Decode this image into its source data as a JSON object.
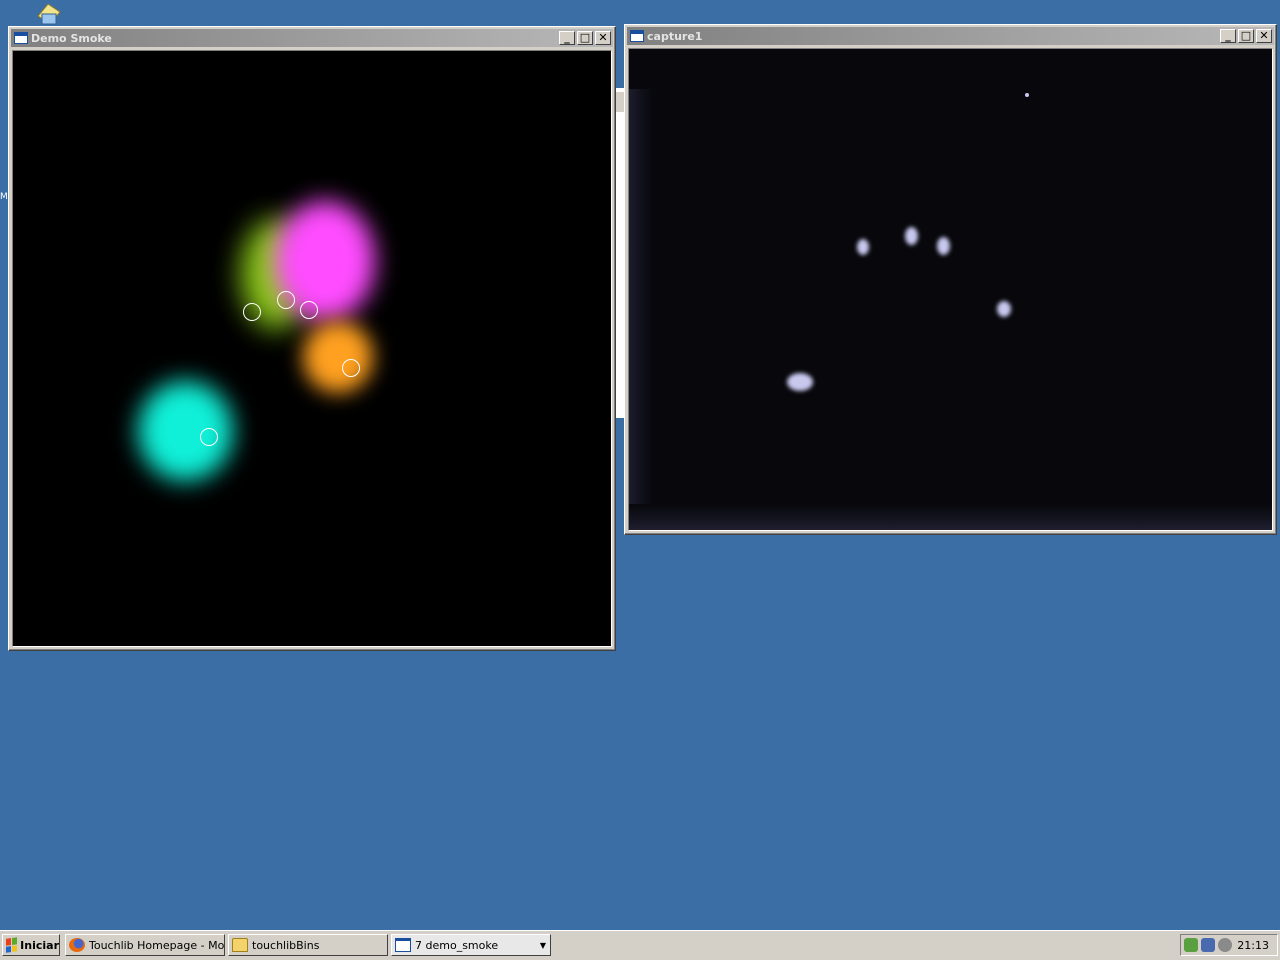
{
  "desktop": {
    "edge_letter": "M"
  },
  "windows": {
    "demo_smoke": {
      "title": "Demo Smoke"
    },
    "capture": {
      "title": "capture1"
    }
  },
  "titlebar_buttons": {
    "minimize": "_",
    "maximize": "□",
    "close": "✕"
  },
  "taskbar": {
    "start_label": "Iniciar",
    "tasks": [
      {
        "label": "Touchlib Homepage - Mo...",
        "icon": "firefox-icon"
      },
      {
        "label": "touchlibBins",
        "icon": "folder-icon"
      },
      {
        "label": "7 demo_smoke",
        "icon": "app-window-icon",
        "active": true
      }
    ],
    "clock": "21:13"
  },
  "colors": {
    "desktop": "#3a6ea5",
    "smoke_magenta": "#ff4cff",
    "smoke_green": "#9be01c",
    "smoke_orange": "#ffa020",
    "smoke_cyan": "#10f0d8",
    "finger_dot": "#c8c8ef"
  }
}
